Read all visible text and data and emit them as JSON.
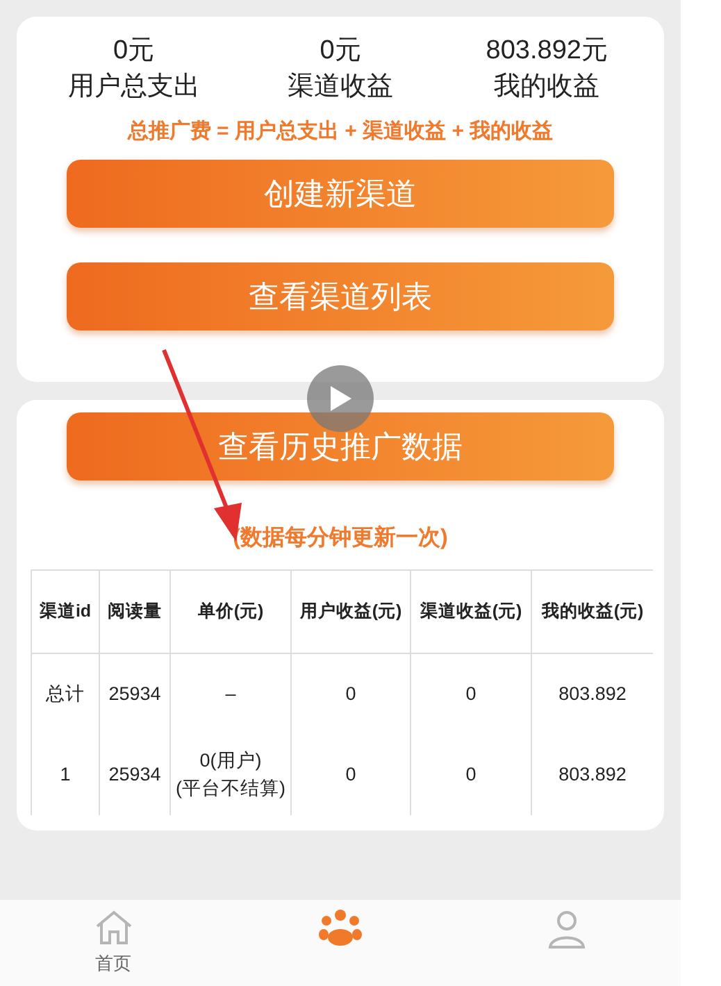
{
  "stats": [
    {
      "value": "0元",
      "label": "用户总支出"
    },
    {
      "value": "0元",
      "label": "渠道收益"
    },
    {
      "value": "803.892元",
      "label": "我的收益"
    }
  ],
  "formula": "总推广费 = 用户总支出 + 渠道收益 + 我的收益",
  "buttons": [
    "创建新渠道",
    "查看渠道列表"
  ],
  "history_button": "查看历史推广数据",
  "note": "(数据每分钟更新一次)",
  "table": {
    "columns": [
      "渠道id",
      "阅读量",
      "单价(元)",
      "用户收益(元)",
      "渠道收益(元)",
      "我的收益(元)"
    ],
    "rows": [
      [
        "总计",
        "25934",
        "–",
        "0",
        "0",
        "803.892"
      ],
      [
        "1",
        "25934",
        "0(用户)\n(平台不结算)",
        "0",
        "0",
        "803.892"
      ]
    ]
  },
  "nav": [
    {
      "kind": "home",
      "label": "首页",
      "selected": false
    },
    {
      "kind": "team",
      "selected": true
    },
    {
      "kind": "user",
      "selected": false
    }
  ]
}
